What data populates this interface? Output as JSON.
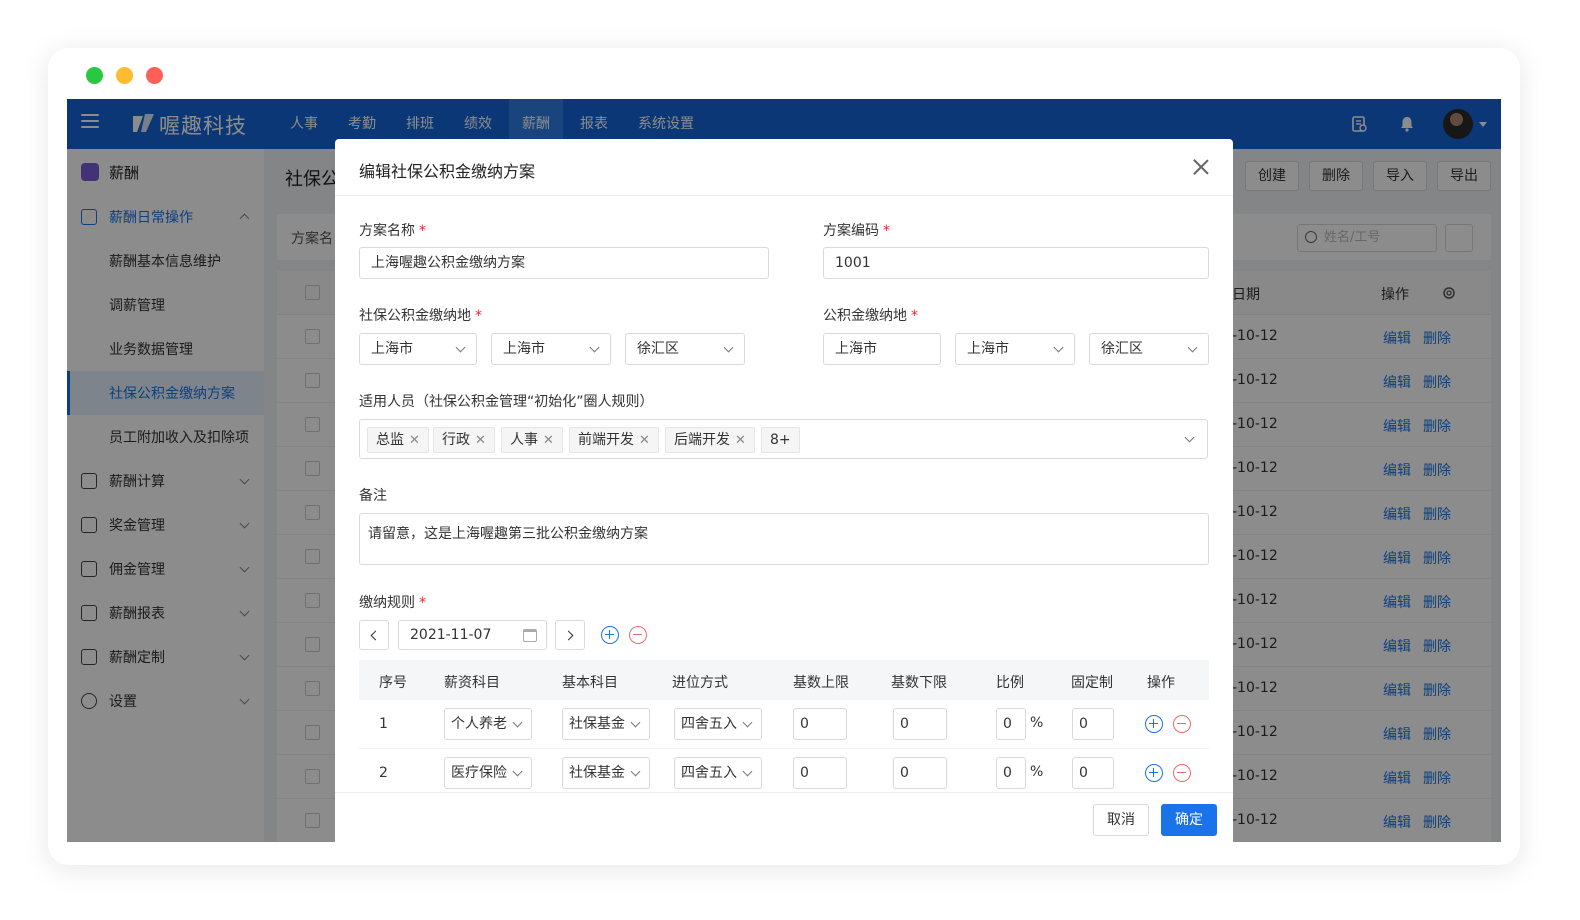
{
  "window": {
    "dots": [
      "#28c840",
      "#febc2e",
      "#ff5f57"
    ]
  },
  "topnav": {
    "logo_text": "喔趣科技",
    "items": [
      "人事",
      "考勤",
      "排班",
      "绩效",
      "薪酬",
      "报表",
      "系统设置"
    ],
    "active_index": 4,
    "colors": {
      "bar": "#1565d8",
      "active": "#2f7ce6"
    }
  },
  "sidebar": {
    "header": "薪酬",
    "groups": [
      {
        "label": "薪酬日常操作",
        "icon": "calendar-icon",
        "open": true,
        "items": [
          "薪酬基本信息维护",
          "调薪管理",
          "业务数据管理",
          "社保公积金缴纳方案",
          "员工附加收入及扣除项"
        ],
        "selected_index": 3
      },
      {
        "label": "薪酬计算",
        "icon": "calculator-icon"
      },
      {
        "label": "奖金管理",
        "icon": "bonus-icon"
      },
      {
        "label": "佣金管理",
        "icon": "commission-icon"
      },
      {
        "label": "薪酬报表",
        "icon": "report-icon"
      },
      {
        "label": "薪酬定制",
        "icon": "folder-icon"
      },
      {
        "label": "设置",
        "icon": "settings-icon"
      }
    ]
  },
  "main": {
    "title": "社保公",
    "buttons": [
      "创建",
      "删除",
      "导入",
      "导出"
    ],
    "filter_label": "方案名",
    "search_placeholder": "姓名/工号",
    "table": {
      "date_header": "日期",
      "op_header": "操作",
      "rows": [
        {
          "date": "-10-12",
          "edit": "编辑",
          "delete": "删除"
        },
        {
          "date": "-10-12",
          "edit": "编辑",
          "delete": "删除"
        },
        {
          "date": "-10-12",
          "edit": "编辑",
          "delete": "删除"
        },
        {
          "date": "-10-12",
          "edit": "编辑",
          "delete": "删除"
        },
        {
          "date": "-10-12",
          "edit": "编辑",
          "delete": "删除"
        },
        {
          "date": "-10-12",
          "edit": "编辑",
          "delete": "删除"
        },
        {
          "date": "-10-12",
          "edit": "编辑",
          "delete": "删除"
        },
        {
          "date": "-10-12",
          "edit": "编辑",
          "delete": "删除"
        },
        {
          "date": "-10-12",
          "edit": "编辑",
          "delete": "删除"
        },
        {
          "date": "-10-12",
          "edit": "编辑",
          "delete": "删除"
        },
        {
          "date": "-10-12",
          "edit": "编辑",
          "delete": "删除"
        },
        {
          "date": "-10-12",
          "edit": "编辑",
          "delete": "删除"
        }
      ]
    }
  },
  "modal": {
    "title": "编辑社保公积金缴纳方案",
    "name_label": "方案名称",
    "name_value": "上海喔趣公积金缴纳方案",
    "code_label": "方案编码",
    "code_value": "1001",
    "social_loc_label": "社保公积金缴纳地",
    "social_loc": [
      "上海市",
      "上海市",
      "徐汇区"
    ],
    "fund_loc_label": "公积金缴纳地",
    "fund_loc": [
      "上海市",
      "上海市",
      "徐汇区"
    ],
    "applicable_label": "适用人员（社保公积金管理“初始化”圈人规则）",
    "tags": [
      "总监",
      "行政",
      "人事",
      "前端开发",
      "后端开发"
    ],
    "tags_more": "8+",
    "remark_label": "备注",
    "remark_value": "请留意，这是上海喔趣第三批公积金缴纳方案",
    "rules_label": "缴纳规则",
    "rules_date": "2021-11-07",
    "rule_columns": [
      "序号",
      "薪资科目",
      "基本科目",
      "进位方式",
      "基数上限",
      "基数下限",
      "比例",
      "固定制",
      "操作"
    ],
    "rule_rows": [
      {
        "no": "1",
        "salary_item": "个人养老",
        "base_item": "社保基金",
        "rounding": "四舍五入",
        "upper": "0",
        "lower": "0",
        "ratio": "0",
        "pct": "%",
        "fixed": "0"
      },
      {
        "no": "2",
        "salary_item": "医疗保险",
        "base_item": "社保基金",
        "rounding": "四舍五入",
        "upper": "0",
        "lower": "0",
        "ratio": "0",
        "pct": "%",
        "fixed": "0"
      }
    ],
    "cancel_label": "取消",
    "ok_label": "确定",
    "colors": {
      "primary": "#1a73e8",
      "danger": "#f06b6b",
      "required": "#f5222d"
    }
  }
}
